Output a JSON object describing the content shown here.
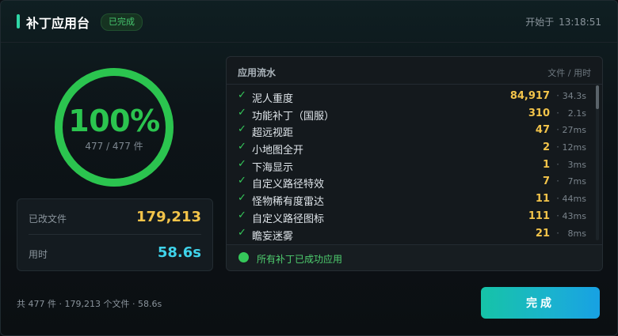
{
  "header": {
    "title": "补丁应用台",
    "badge": "已完成",
    "started_label": "开始于",
    "started_time": "13:18:51"
  },
  "progress": {
    "percent_text": "100%",
    "percent": 100,
    "count_text": "477 / 477 件"
  },
  "stats": {
    "files_label": "已改文件",
    "files_value": "179,213",
    "time_label": "用时",
    "time_value": "58.6s"
  },
  "flow": {
    "title": "应用流水",
    "columns": "文件 / 用时",
    "items": [
      {
        "name": "泥人重度",
        "count": "84,917",
        "time": "34.3s"
      },
      {
        "name": "功能补丁（国服）",
        "count": "310",
        "time": "2.1s"
      },
      {
        "name": "超远视距",
        "count": "47",
        "time": "27ms"
      },
      {
        "name": "小地图全开",
        "count": "2",
        "time": "12ms"
      },
      {
        "name": "下海显示",
        "count": "1",
        "time": "3ms"
      },
      {
        "name": "自定义路径特效",
        "count": "7",
        "time": "7ms"
      },
      {
        "name": "怪物稀有度雷达",
        "count": "11",
        "time": "44ms"
      },
      {
        "name": "自定义路径图标",
        "count": "111",
        "time": "43ms"
      },
      {
        "name": "瞻妄迷雾",
        "count": "21",
        "time": "8ms"
      }
    ],
    "check_glyph": "✓",
    "separator": "·",
    "footer": "所有补丁已成功应用"
  },
  "footer": {
    "summary": "共 477 件 · 179,213 个文件 · 58.6s",
    "done_label": "完成"
  },
  "colors": {
    "accent_green": "#2bc44f",
    "accent_gold": "#f3c44a",
    "accent_cyan": "#3fd3ea",
    "button_start": "#16c3a7",
    "button_end": "#18a1e3"
  }
}
